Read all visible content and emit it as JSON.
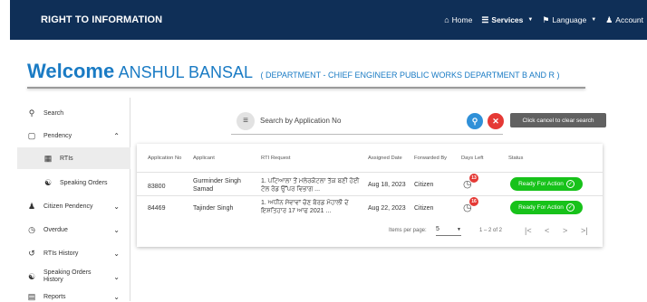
{
  "header": {
    "brand": "RIGHT TO INFORMATION",
    "nav": {
      "home": "Home",
      "services": "Services",
      "language": "Language",
      "account": "Account"
    }
  },
  "welcome": {
    "word": "Welcome",
    "name": "ANSHUL BANSAL",
    "department": "( DEPARTMENT - CHIEF ENGINEER PUBLIC WORKS DEPARTMENT B AND R )"
  },
  "sidebar": {
    "items": [
      {
        "label": "Search",
        "icon": "search-icon"
      },
      {
        "label": "Pendency",
        "icon": "monitor-icon"
      },
      {
        "label": "RTIs",
        "icon": "grid-icon"
      },
      {
        "label": "Speaking Orders",
        "icon": "speaker-person-icon"
      },
      {
        "label": "Citizen Pendency",
        "icon": "person-icon"
      },
      {
        "label": "Overdue",
        "icon": "clock-icon"
      },
      {
        "label": "RTIs History",
        "icon": "history-icon"
      },
      {
        "label": "Speaking Orders History",
        "icon": "speaker-person-icon"
      },
      {
        "label": "Reports",
        "icon": "report-icon"
      }
    ]
  },
  "search": {
    "placeholder": "Search by Application No",
    "cancel_tooltip": "Click cancel to clear search"
  },
  "table": {
    "columns": [
      "Application No",
      "Applicant",
      "RTI Request",
      "Assigned Date",
      "Forwarded By",
      "Days Left",
      "Status"
    ],
    "rows": [
      {
        "app_no": "83800",
        "applicant": "Gurminder Singh Samad",
        "request": "1. ਪਟਿਆਲਾ ਤੋਂ ਮਲੇਰਕੋਟਲਾ ਤੱਕ ਬਣੀ ਹੋਈ ਟੋਲ ਰੋਡ ਉੱਪਰ ਵਿਭਾਗ ...",
        "assigned_date": "Aug 18, 2023",
        "forwarded_by": "Citizen",
        "days_left": "13",
        "status": "Ready For Action"
      },
      {
        "app_no": "84469",
        "applicant": "Tajinder Singh",
        "request": "1. ਅਧੀਨ ਸੇਵਾਵਾਂ ਚੋਣ ਬੋਰਡ ਮੋਹਾਲੀ ਦੇ ਇਸ਼ਤਿਹਾਰ 17 ਆਫ 2021 ...",
        "assigned_date": "Aug 22, 2023",
        "forwarded_by": "Citizen",
        "days_left": "16",
        "status": "Ready For Action"
      }
    ]
  },
  "pagination": {
    "items_per_page_label": "Items per page:",
    "items_per_page": "5",
    "range": "1 – 2 of 2"
  },
  "colors": {
    "header_bg": "#0f2f57",
    "accent": "#1a7bc4",
    "status_green": "#17c21a",
    "danger": "#e53935"
  }
}
